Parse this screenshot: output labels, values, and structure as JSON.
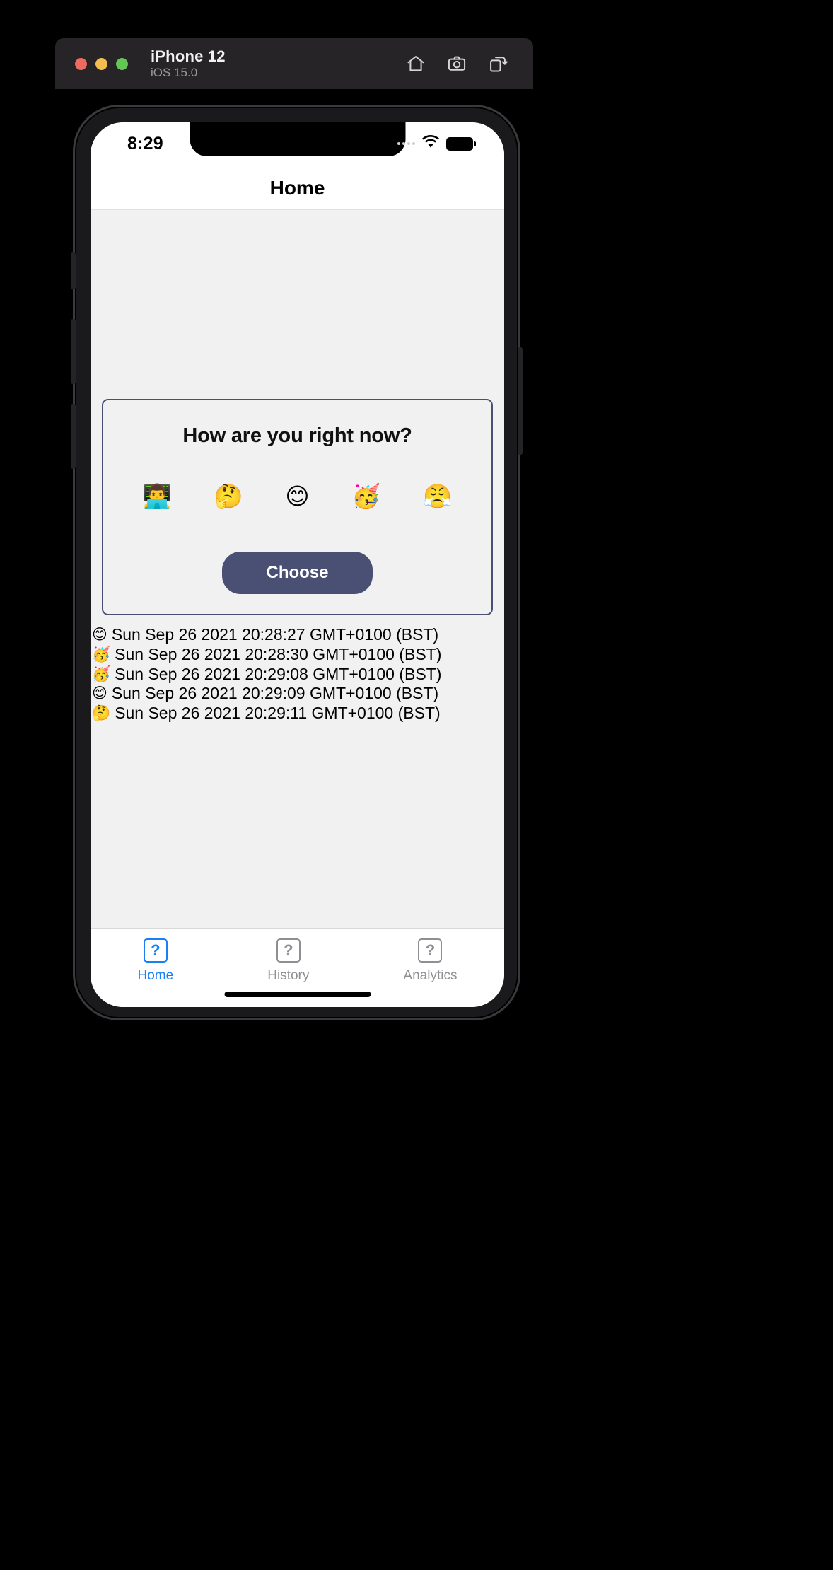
{
  "simulator": {
    "device_name": "iPhone 12",
    "os_version": "iOS 15.0",
    "traffic_lights": {
      "close": "close-button",
      "minimize": "minimize-button",
      "zoom": "zoom-button"
    },
    "actions": [
      {
        "name": "home-icon",
        "label": "Home"
      },
      {
        "name": "screenshot-icon",
        "label": "Screenshot"
      },
      {
        "name": "rotate-icon",
        "label": "Rotate"
      }
    ]
  },
  "statusbar": {
    "time": "8:29",
    "wifi": "wifi-icon",
    "battery": "battery-icon"
  },
  "navbar": {
    "title": "Home"
  },
  "survey": {
    "question": "How are you right now?",
    "options": [
      {
        "emoji": "👨‍💻",
        "name": "mood-option-working"
      },
      {
        "emoji": "🤔",
        "name": "mood-option-thinking"
      },
      {
        "emoji": "😊",
        "name": "mood-option-happy"
      },
      {
        "emoji": "🥳",
        "name": "mood-option-partying"
      },
      {
        "emoji": "😤",
        "name": "mood-option-frustrated"
      }
    ],
    "submit_label": "Choose",
    "accent_color": "#4a5074"
  },
  "history": {
    "entries": [
      {
        "emoji": "😊",
        "timestamp": "Sun Sep 26 2021 20:28:27 GMT+0100 (BST)"
      },
      {
        "emoji": "🥳",
        "timestamp": "Sun Sep 26 2021 20:28:30 GMT+0100 (BST)"
      },
      {
        "emoji": "🥳",
        "timestamp": "Sun Sep 26 2021 20:29:08 GMT+0100 (BST)"
      },
      {
        "emoji": "😊",
        "timestamp": "Sun Sep 26 2021 20:29:09 GMT+0100 (BST)"
      },
      {
        "emoji": "🤔",
        "timestamp": "Sun Sep 26 2021 20:29:11 GMT+0100 (BST)"
      }
    ]
  },
  "tabbar": {
    "active_color": "#1a7ef5",
    "inactive_color": "#8e8e93",
    "tabs": [
      {
        "label": "Home",
        "glyph": "?",
        "active": true
      },
      {
        "label": "History",
        "glyph": "?",
        "active": false
      },
      {
        "label": "Analytics",
        "glyph": "?",
        "active": false
      }
    ]
  }
}
